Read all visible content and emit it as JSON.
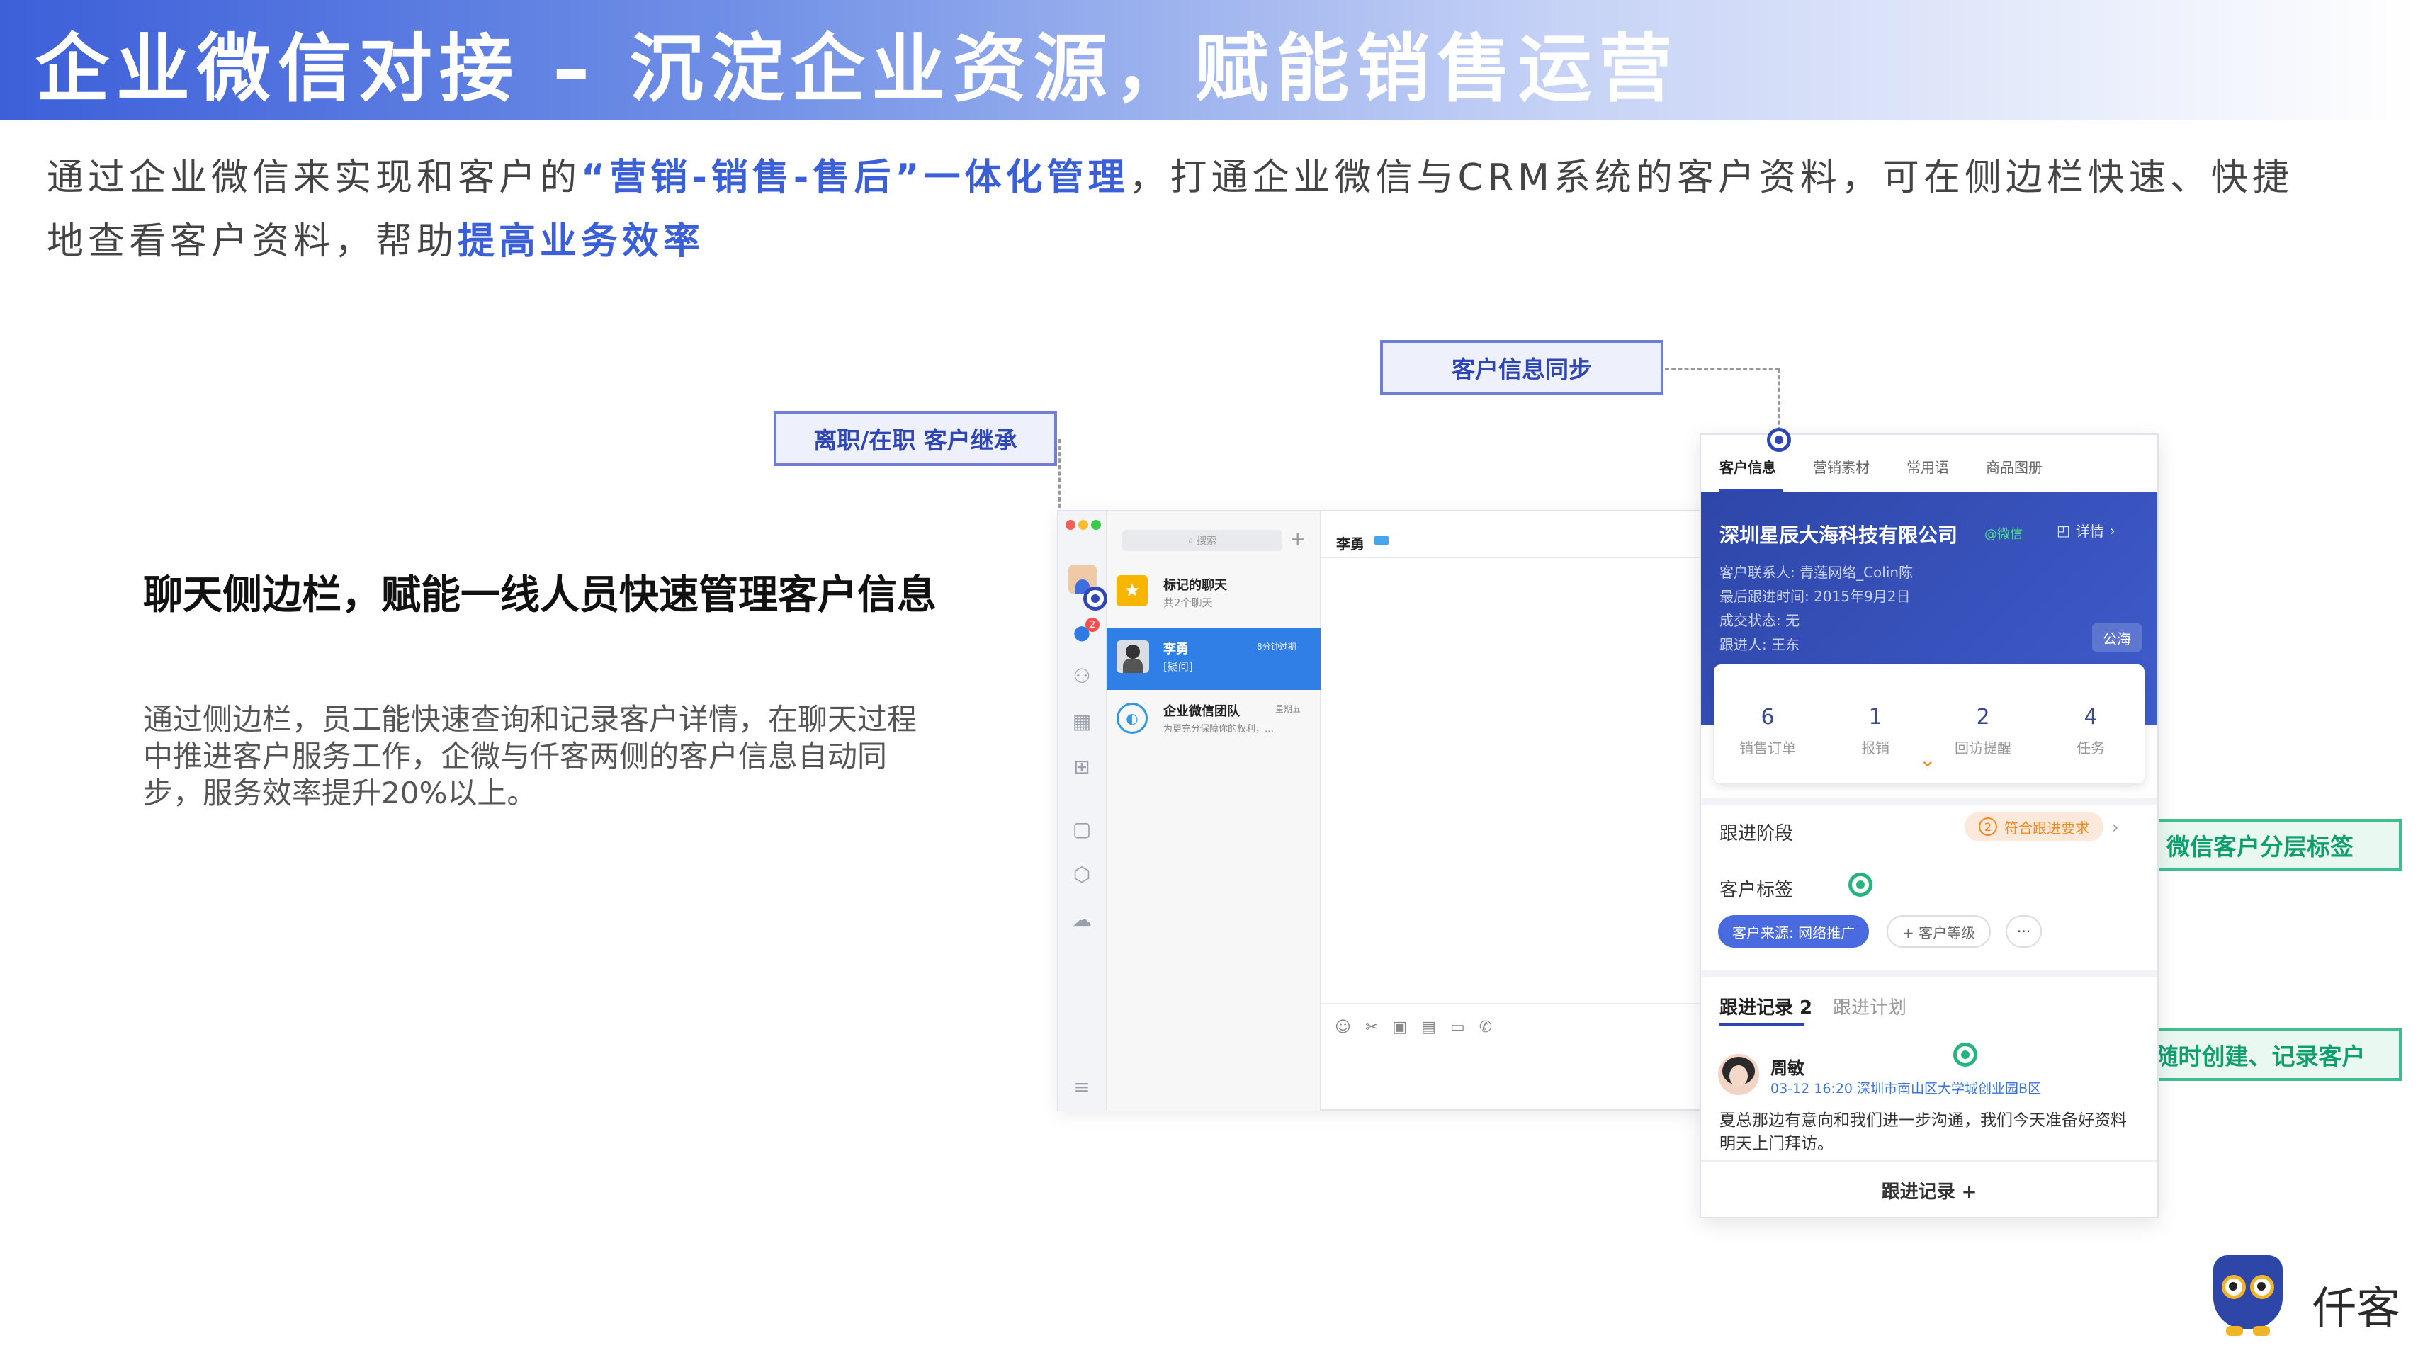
{
  "banner": {
    "title": "企业微信对接 – 沉淀企业资源，赋能销售运营"
  },
  "intro": {
    "part1": "通过企业微信来实现和客户的",
    "hl1": "“营销-销售-售后”一体化管理",
    "part2": "，打通企业微信与CRM系统的客户资料，可在侧边栏快速、快捷地查看客户资料，帮助",
    "hl2": "提高业务效率"
  },
  "callouts": {
    "sync": "客户信息同步",
    "inherit": "离职/在职 客户继承",
    "tags": "微信客户分层标签",
    "record": "随时创建、记录客户"
  },
  "feature": {
    "title": "聊天侧边栏，赋能一线人员快速管理客户信息",
    "desc": "通过侧边栏，员工能快速查询和记录客户详情，在聊天过程中推进客户服务工作，企微与仟客两侧的客户信息自动同步，服务效率提升20%以上。"
  },
  "chat": {
    "search_placeholder": "搜索",
    "add": "+",
    "chat_title": "李勇",
    "conversations": [
      {
        "name": "标记的聊天",
        "sub": "共2个聊天",
        "time": ""
      },
      {
        "name": "李勇",
        "sub": "[疑问]",
        "time": "8分钟过期"
      },
      {
        "name": "企业微信团队",
        "sub": "为更充分保障你的权利，…",
        "time": "星期五"
      }
    ],
    "badge": "2",
    "toolbar_icons": [
      "smile-icon",
      "scissors-icon",
      "image-icon",
      "file-icon",
      "folder-icon",
      "phone-icon"
    ]
  },
  "sidebar": {
    "tabs": [
      "客户信息",
      "营销素材",
      "常用语",
      "商品图册"
    ],
    "company": "深圳星辰大海科技有限公司",
    "wechat_tag": "@微信",
    "detail": "详情",
    "contact": "客户联系人: 青莲网络_Colin陈",
    "last_follow": "最后跟进时间: 2015年9月2日",
    "deal_status": "成交状态: 无",
    "follower": "跟进人: 王东",
    "pool": "公海",
    "stats": [
      {
        "value": "6",
        "label": "销售订单"
      },
      {
        "value": "1",
        "label": "报销"
      },
      {
        "value": "2",
        "label": "回访提醒"
      },
      {
        "value": "4",
        "label": "任务"
      }
    ],
    "stage_label": "跟进阶段",
    "stage_num": "2",
    "stage_value": "符合跟进要求",
    "tag_label": "客户标签",
    "tag_source": "客户来源: 网络推广",
    "tag_level": "+ 客户等级",
    "tag_more": "···",
    "record_tab": "跟进记录 2",
    "plan_tab": "跟进计划",
    "record_user": "周敏",
    "record_meta": "03-12 16:20 深圳市南山区大学城创业园B区",
    "record_text": "夏总那边有意向和我们进一步沟通，我们今天准备好资料明天上门拜访。",
    "add_record": "跟进记录 +"
  },
  "brand": {
    "name": "仟客"
  }
}
